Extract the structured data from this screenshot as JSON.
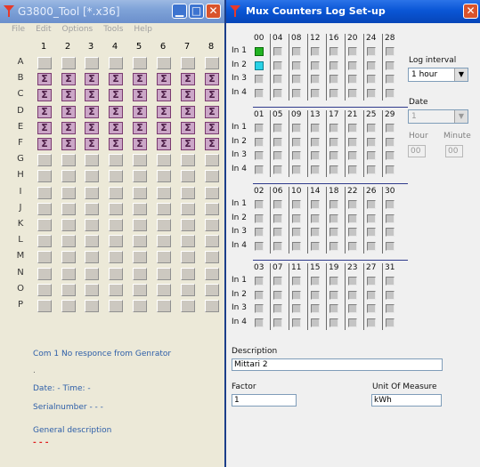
{
  "left_window": {
    "title": "G3800_Tool [*.x36]",
    "menu": [
      "File",
      "Edit",
      "Options",
      "Tools",
      "Help"
    ],
    "columns": [
      "1",
      "2",
      "3",
      "4",
      "5",
      "6",
      "7",
      "8"
    ],
    "rows": [
      "A",
      "B",
      "C",
      "D",
      "E",
      "F",
      "G",
      "H",
      "I",
      "J",
      "K",
      "L",
      "M",
      "N",
      "O",
      "P"
    ],
    "sigma_rows": [
      "B",
      "C",
      "D",
      "E",
      "F"
    ],
    "sigma_glyph": "Σ",
    "status": "Com 1 No responce from Genrator",
    "dot": ".",
    "date_time": "Date: - Time: -",
    "serial": "Serialnumber - - -",
    "general_label": "General description",
    "general_value": "- - -",
    "close_glyph": "✕"
  },
  "right_window": {
    "title": "Mux Counters Log Set-up",
    "close_glyph": "✕",
    "blocks": [
      {
        "counters": [
          "00",
          "04",
          "08",
          "12",
          "16",
          "20",
          "24",
          "28"
        ]
      },
      {
        "counters": [
          "01",
          "05",
          "09",
          "13",
          "17",
          "21",
          "25",
          "29"
        ]
      },
      {
        "counters": [
          "02",
          "06",
          "10",
          "14",
          "18",
          "22",
          "26",
          "30"
        ]
      },
      {
        "counters": [
          "03",
          "07",
          "11",
          "15",
          "19",
          "23",
          "27",
          "31"
        ]
      }
    ],
    "inputs": [
      "In 1",
      "In 2",
      "In 3",
      "In 4"
    ],
    "active": {
      "green": "In 1 / 00",
      "cyan": "In 2 / 00"
    },
    "log_interval_label": "Log interval",
    "log_interval_value": "1 hour",
    "date_label": "Date",
    "date_value": "1",
    "hour_label": "Hour",
    "minute_label": "Minute",
    "hour_value": "00",
    "minute_value": "00",
    "description_label": "Description",
    "description_value": "Mittari 2",
    "factor_label": "Factor",
    "factor_value": "1",
    "unit_label": "Unit Of Measure",
    "unit_value": "kWh"
  },
  "colors": {
    "sigma_fill": "#cba6c7",
    "status_text": "#2d5ea8",
    "general_value": "#e02020",
    "active_green": "#22b322",
    "active_cyan": "#2ad2e6"
  }
}
